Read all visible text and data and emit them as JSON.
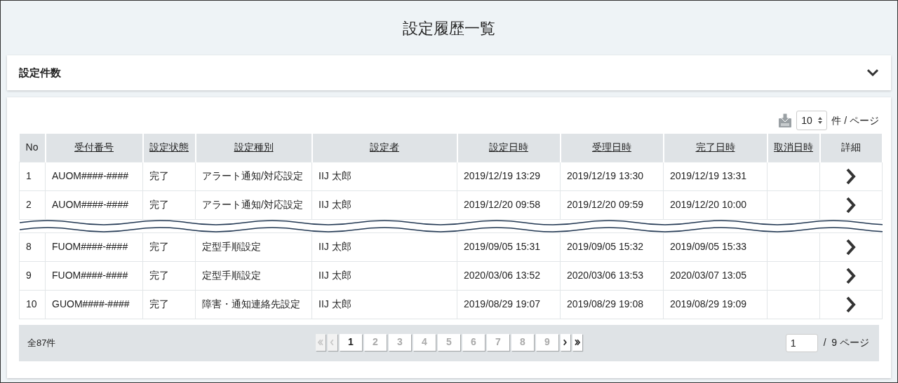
{
  "page_title": "設定履歴一覧",
  "summary_panel": {
    "title": "設定件数",
    "expanded": false
  },
  "toolbar": {
    "per_page": "10",
    "per_page_suffix": "件 / ページ"
  },
  "table": {
    "columns": [
      {
        "label": "No",
        "sortable": false
      },
      {
        "label": "受付番号",
        "sortable": true
      },
      {
        "label": "設定状態",
        "sortable": true
      },
      {
        "label": "設定種別",
        "sortable": true
      },
      {
        "label": "設定者",
        "sortable": true
      },
      {
        "label": "設定日時",
        "sortable": true
      },
      {
        "label": "受理日時",
        "sortable": true
      },
      {
        "label": "完了日時",
        "sortable": true
      },
      {
        "label": "取消日時",
        "sortable": true
      },
      {
        "label": "詳細",
        "sortable": false
      }
    ],
    "row_groups": [
      [
        {
          "cells": [
            "1",
            "AUOM####-####",
            "完了",
            "アラート通知/対応設定",
            "IIJ 太郎",
            "2019/12/19 13:29",
            "2019/12/19 13:30",
            "2019/12/19 13:31",
            ""
          ]
        },
        {
          "cells": [
            "2",
            "AUOM####-####",
            "完了",
            "アラート通知/対応設定",
            "IIJ 太郎",
            "2019/12/20 09:58",
            "2019/12/20 09:59",
            "2019/12/20 10:00",
            ""
          ]
        }
      ],
      [
        {
          "cells": [
            "8",
            "FUOM####-####",
            "完了",
            "定型手順設定",
            "IIJ 太郎",
            "2019/09/05 15:31",
            "2019/09/05 15:32",
            "2019/09/05 15:33",
            ""
          ]
        },
        {
          "cells": [
            "9",
            "FUOM####-####",
            "完了",
            "定型手順設定",
            "IIJ 太郎",
            "2020/03/06 13:52",
            "2020/03/06 13:53",
            "2020/03/07 13:05",
            ""
          ]
        },
        {
          "cells": [
            "10",
            "GUOM####-####",
            "完了",
            "障害・通知連絡先設定",
            "IIJ 太郎",
            "2019/08/29 19:07",
            "2019/08/29 19:08",
            "2019/08/29 19:09",
            ""
          ]
        }
      ]
    ]
  },
  "footer": {
    "total": "全87件",
    "pager": [
      {
        "kind": "first",
        "disabled": true
      },
      {
        "kind": "prev",
        "disabled": true
      },
      {
        "kind": "page",
        "label": "1",
        "selected": true
      },
      {
        "kind": "page",
        "label": "2",
        "selected": false
      },
      {
        "kind": "page",
        "label": "3",
        "selected": false
      },
      {
        "kind": "page",
        "label": "4",
        "selected": false
      },
      {
        "kind": "page",
        "label": "5",
        "selected": false
      },
      {
        "kind": "page",
        "label": "6",
        "selected": false
      },
      {
        "kind": "page",
        "label": "7",
        "selected": false
      },
      {
        "kind": "page",
        "label": "8",
        "selected": false
      },
      {
        "kind": "page",
        "label": "9",
        "selected": false
      },
      {
        "kind": "next",
        "disabled": false
      },
      {
        "kind": "last",
        "disabled": false
      }
    ],
    "page_input": "1",
    "page_total": "/  9 ページ"
  }
}
